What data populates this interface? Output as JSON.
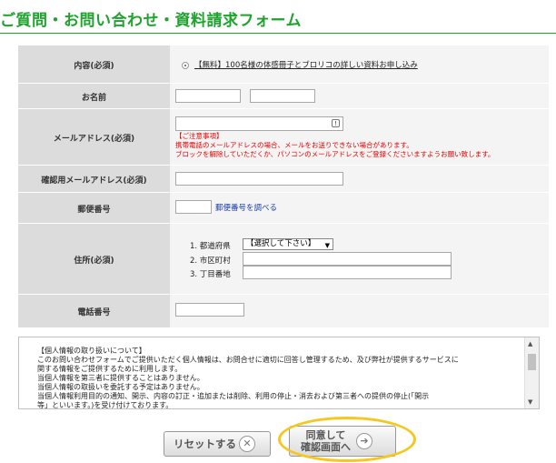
{
  "title": "ご質問・お問い合わせ・資料請求フォーム",
  "form": {
    "contents": {
      "label": "内容(必須)",
      "option": "【無料】100名様の体感冊子とブロリコの詳しい資料お申し込み"
    },
    "name": {
      "label": "お名前"
    },
    "email": {
      "label": "メールアドレス(必須)",
      "note_title": "【ご注意事項】",
      "note_line1": "携帯電話のメールアドレスの場合、メールをお送りできない場合があります。",
      "note_line2": "ブロックを解除していただくか、パソコンのメールアドレスをご登録くださいますようお願い致します。"
    },
    "email_confirm": {
      "label": "確認用メールアドレス(必須)"
    },
    "postal": {
      "label": "郵便番号",
      "lookup_link": "郵便番号を調べる"
    },
    "address": {
      "label": "住所(必須)",
      "pref_label": "1. 都道府県",
      "pref_select": "【選択して下さい】",
      "city_label": "2. 市区町村",
      "street_label": "3. 丁目番地"
    },
    "phone": {
      "label": "電話番号"
    }
  },
  "privacy": {
    "text": "【個人情報の取り扱いについて】\nこのお問い合わせフォームでご提供いただく個人情報は、お問合せに適切に回答し管理するため、及び弊社が提供するサービスに\n関する情報をご提供するために利用します。\n当個人情報を第三者に提供することはありません。\n当個人情報の取扱いを委託する予定はありません。\n当個人情報利用目的の通知、開示、内容の訂正・追加または削除、利用の停止・消去および第三者への提供の停止(「開示\n等」といいます。)を受け付けております。"
  },
  "buttons": {
    "reset": "リセットする",
    "confirm_line1": "同意して",
    "confirm_line2": "確認画面へ"
  },
  "colors": {
    "accent": "#1fa32e",
    "highlight": "#f6c81e",
    "warning": "#e60000",
    "link": "#1a3ea8"
  }
}
